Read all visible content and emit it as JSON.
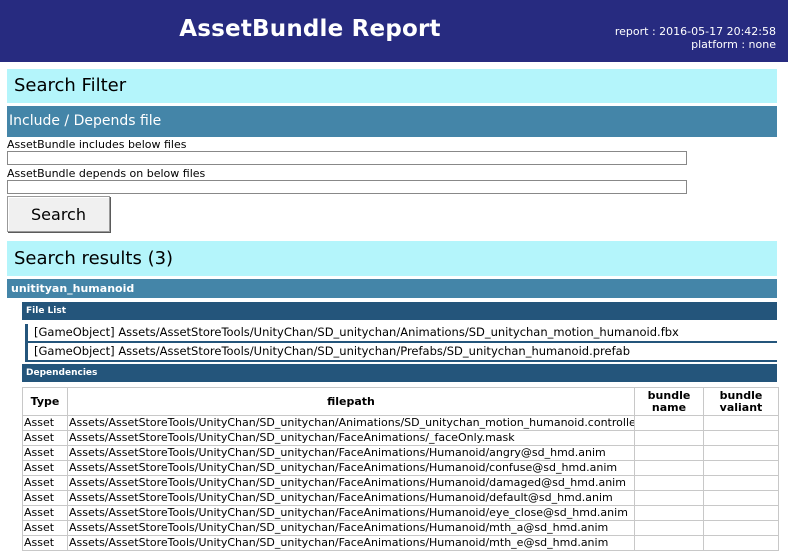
{
  "header": {
    "title": "AssetBundle Report",
    "report": "report : 2016-05-17 20:42:58",
    "platform": "platform : none"
  },
  "search_filter": {
    "title": "Search Filter",
    "section": "Include / Depends file",
    "includes_label": "AssetBundle includes below files",
    "includes_value": "",
    "depends_label": "AssetBundle depends on below files",
    "depends_value": "",
    "search_button": "Search"
  },
  "results": {
    "title": "Search results (3)",
    "group_name": "unitityan_humanoid",
    "file_list_label": "File List",
    "files": [
      "[GameObject] Assets/AssetStoreTools/UnityChan/SD_unitychan/Animations/SD_unitychan_motion_humanoid.fbx",
      "[GameObject] Assets/AssetStoreTools/UnityChan/SD_unitychan/Prefabs/SD_unitychan_humanoid.prefab"
    ],
    "dependencies_label": "Dependencies",
    "columns": [
      "Type",
      "filepath",
      "bundle name",
      "bundle valiant"
    ],
    "rows": [
      {
        "type": "Asset",
        "filepath": "Assets/AssetStoreTools/UnityChan/SD_unitychan/Animations/SD_unitychan_motion_humanoid.controller",
        "bundle_name": "",
        "bundle_variant": ""
      },
      {
        "type": "Asset",
        "filepath": "Assets/AssetStoreTools/UnityChan/SD_unitychan/FaceAnimations/_faceOnly.mask",
        "bundle_name": "",
        "bundle_variant": ""
      },
      {
        "type": "Asset",
        "filepath": "Assets/AssetStoreTools/UnityChan/SD_unitychan/FaceAnimations/Humanoid/angry@sd_hmd.anim",
        "bundle_name": "",
        "bundle_variant": ""
      },
      {
        "type": "Asset",
        "filepath": "Assets/AssetStoreTools/UnityChan/SD_unitychan/FaceAnimations/Humanoid/confuse@sd_hmd.anim",
        "bundle_name": "",
        "bundle_variant": ""
      },
      {
        "type": "Asset",
        "filepath": "Assets/AssetStoreTools/UnityChan/SD_unitychan/FaceAnimations/Humanoid/damaged@sd_hmd.anim",
        "bundle_name": "",
        "bundle_variant": ""
      },
      {
        "type": "Asset",
        "filepath": "Assets/AssetStoreTools/UnityChan/SD_unitychan/FaceAnimations/Humanoid/default@sd_hmd.anim",
        "bundle_name": "",
        "bundle_variant": ""
      },
      {
        "type": "Asset",
        "filepath": "Assets/AssetStoreTools/UnityChan/SD_unitychan/FaceAnimations/Humanoid/eye_close@sd_hmd.anim",
        "bundle_name": "",
        "bundle_variant": ""
      },
      {
        "type": "Asset",
        "filepath": "Assets/AssetStoreTools/UnityChan/SD_unitychan/FaceAnimations/Humanoid/mth_a@sd_hmd.anim",
        "bundle_name": "",
        "bundle_variant": ""
      },
      {
        "type": "Asset",
        "filepath": "Assets/AssetStoreTools/UnityChan/SD_unitychan/FaceAnimations/Humanoid/mth_e@sd_hmd.anim",
        "bundle_name": "",
        "bundle_variant": ""
      }
    ]
  },
  "colors": {
    "header_bg": "#272b80",
    "panel_title_bg": "#b4f5fb",
    "section_bar_bg": "#4485a8",
    "dark_bar_bg": "#24557b"
  }
}
